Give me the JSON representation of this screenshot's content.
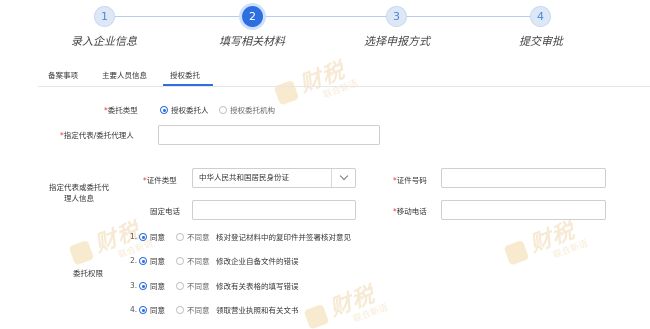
{
  "stepper": {
    "steps": [
      {
        "number": "1",
        "label": "录入企业信息",
        "state": "done"
      },
      {
        "number": "2",
        "label": "填写相关材料",
        "state": "active"
      },
      {
        "number": "3",
        "label": "选择申报方式",
        "state": "todo"
      },
      {
        "number": "4",
        "label": "提交审批",
        "state": "todo"
      }
    ],
    "active_color": "#2e6fe0"
  },
  "tabs": [
    {
      "label": "备案事项"
    },
    {
      "label": "主要人员信息"
    },
    {
      "label": "授权委托"
    }
  ],
  "active_tab": "授权委托",
  "form": {
    "entrust_type": {
      "label": "委托类型",
      "options": [
        "授权委托人",
        "授权委托机构"
      ],
      "selected": "授权委托人"
    },
    "agent_name": {
      "label": "指定代表/委托代理人",
      "value": ""
    },
    "agent_info_label": "指定代表或委托代理人信息",
    "id_type": {
      "label": "证件类型",
      "value": "中华人民共和国居民身份证"
    },
    "id_number": {
      "label": "证件号码",
      "value": ""
    },
    "landline": {
      "label": "固定电话",
      "value": ""
    },
    "mobile": {
      "label": "移动电话",
      "value": ""
    },
    "authority": {
      "label": "委托权限",
      "yes_label": "同意",
      "no_label": "不同意",
      "items": [
        {
          "number": "1.",
          "text": "核对登记材料中的复印件并签署核对意见",
          "selected": "同意"
        },
        {
          "number": "2.",
          "text": "修改企业自备文件的错误",
          "selected": "同意"
        },
        {
          "number": "3.",
          "text": "修改有关表格的填写错误",
          "selected": "同意"
        },
        {
          "number": "4.",
          "text": "领取营业执照和有关文书",
          "selected": "同意"
        }
      ]
    }
  },
  "watermark": {
    "big": "财税",
    "small": "联合新语"
  }
}
